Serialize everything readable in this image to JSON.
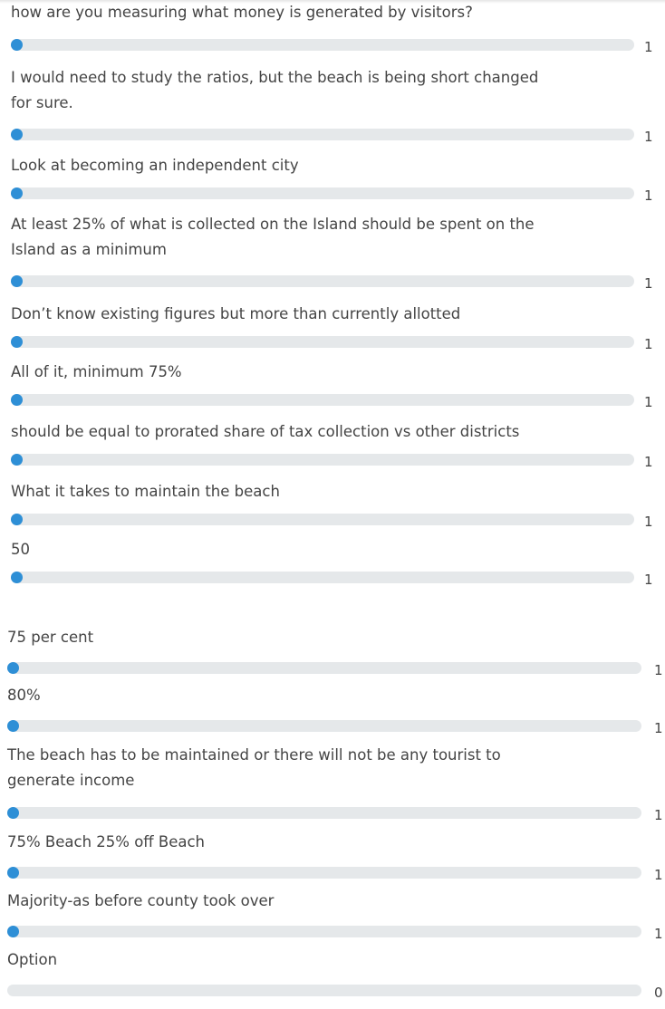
{
  "sections": [
    {
      "items": [
        {
          "label": "how are you measuring what money is generated by visitors?",
          "count": "1",
          "fraction": 0
        },
        {
          "label": "I would need to study the ratios, but the beach is being short changed\nfor sure.",
          "count": "1",
          "fraction": 0
        },
        {
          "label": "Look at becoming an independent city",
          "count": "1",
          "fraction": 0
        },
        {
          "label": "At least 25% of what is collected on the Island should be spent on the\nIsland as a minimum",
          "count": "1",
          "fraction": 0
        },
        {
          "label": "Don’t know existing figures but more than currently allotted",
          "count": "1",
          "fraction": 0
        },
        {
          "label": "All of it, minimum 75%",
          "count": "1",
          "fraction": 0
        },
        {
          "label": "should be equal to prorated share of tax collection vs other districts",
          "count": "1",
          "fraction": 0
        },
        {
          "label": "What it takes to maintain the beach",
          "count": "1",
          "fraction": 0
        },
        {
          "label": "50",
          "count": "1",
          "fraction": 0
        }
      ]
    },
    {
      "items": [
        {
          "label": "75 per cent",
          "count": "1",
          "fraction": 0
        },
        {
          "label": "80%",
          "count": "1",
          "fraction": 0
        },
        {
          "label": "The beach has to be maintained or there will not be any tourist to\ngenerate income",
          "count": "1",
          "fraction": 0
        },
        {
          "label": "75% Beach 25% off Beach",
          "count": "1",
          "fraction": 0
        },
        {
          "label": "Majority-as before county took over",
          "count": "1",
          "fraction": 0
        },
        {
          "label": "Option",
          "count": "0",
          "fraction": 0
        }
      ]
    }
  ],
  "colors": {
    "fill": "#2e8fd6",
    "track": "#e5e8ea",
    "text": "#444444"
  }
}
